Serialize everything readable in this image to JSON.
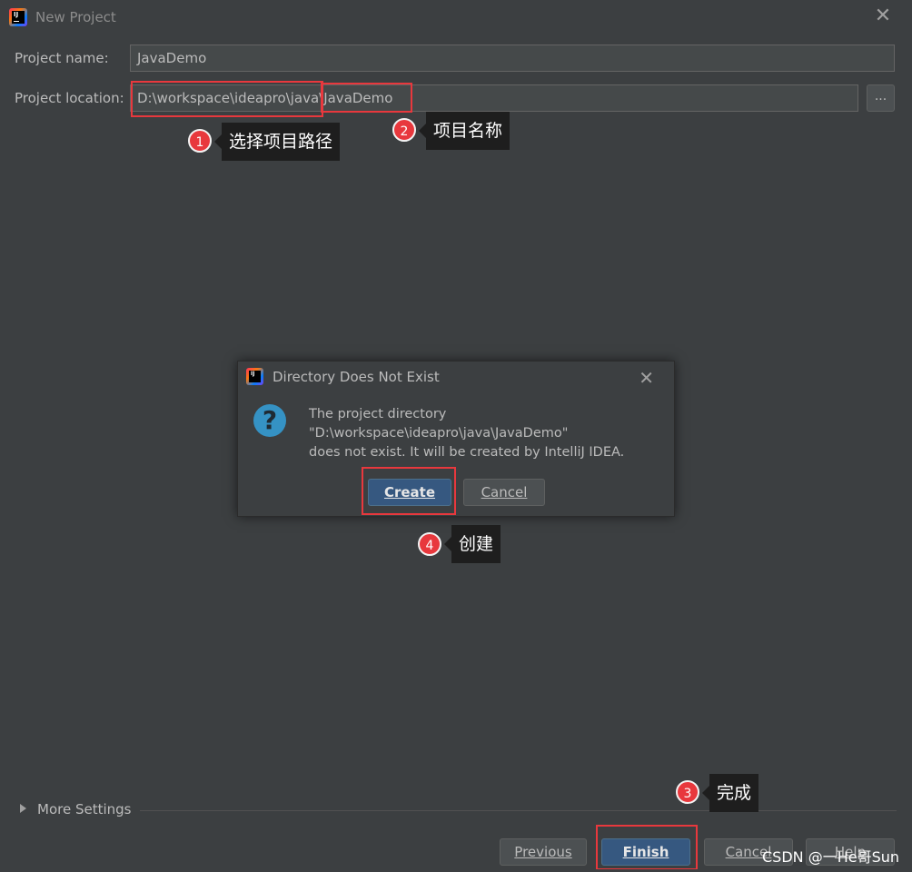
{
  "window": {
    "title": "New Project",
    "close_glyph": "✕",
    "app_icon": "intellij-idea-icon",
    "app_icon_text": "IJ"
  },
  "form": {
    "name_label": "Project name:",
    "name_value": "JavaDemo",
    "location_label": "Project location:",
    "location_value": "D:\\workspace\\ideapro\\java\\JavaDemo",
    "browse_label": "..."
  },
  "annotations": [
    {
      "number": "1",
      "text": "选择项目路径"
    },
    {
      "number": "2",
      "text": "项目名称"
    },
    {
      "number": "3",
      "text": "完成"
    },
    {
      "number": "4",
      "text": "创建"
    }
  ],
  "dialog": {
    "title": "Directory Does Not Exist",
    "close_glyph": "✕",
    "icon": "question-icon",
    "icon_glyph": "?",
    "message_line1": "The project directory",
    "message_line2": "\"D:\\workspace\\ideapro\\java\\JavaDemo\"",
    "message_line3": "does not exist. It will be created by IntelliJ IDEA.",
    "create_label": "Create",
    "cancel_label": "Cancel"
  },
  "footer": {
    "more_settings_label": "More Settings",
    "previous_label": "Previous",
    "finish_label": "Finish",
    "cancel_label": "Cancel",
    "help_label": "Help"
  },
  "watermark": "CSDN @一He哥Sun",
  "colors": {
    "background": "#3c3f41",
    "accent_red": "#e8383d",
    "primary_button": "#365880",
    "question_blue": "#3592c4"
  }
}
